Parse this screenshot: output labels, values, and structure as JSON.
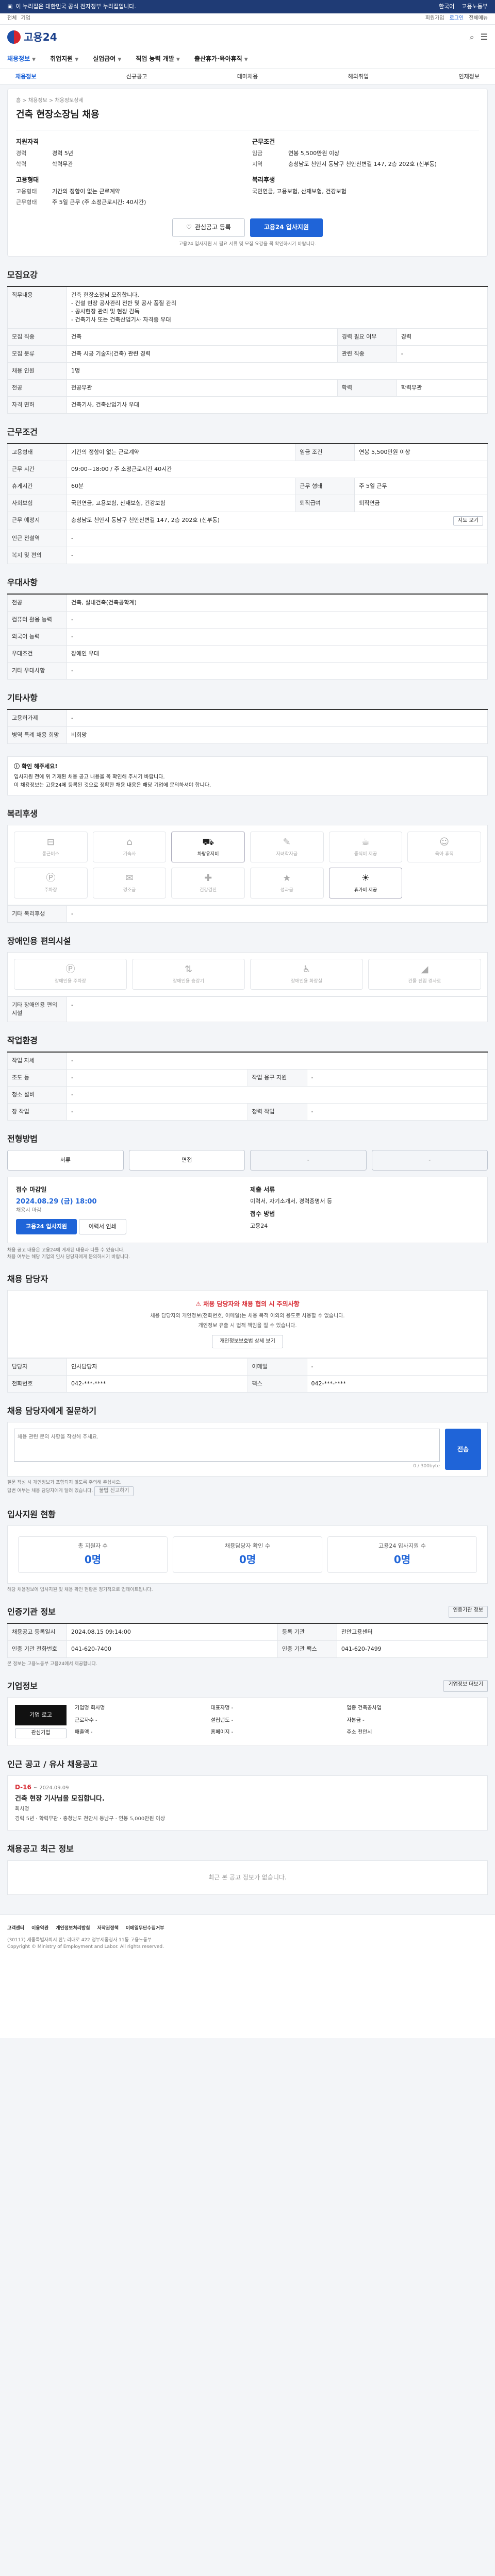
{
  "topbar": {
    "notice": "이 누리집은 대한민국 공식 전자정부 누리집입니다.",
    "lang": "한국어",
    "gov": "고용노동부"
  },
  "util": {
    "left": [
      "전체",
      "기업"
    ],
    "links": [
      "회원가입",
      "로그인",
      "전체메뉴"
    ]
  },
  "logo": "고용24",
  "gnb": [
    {
      "label": "채용정보",
      "on": true
    },
    {
      "label": "취업지원",
      "on": false
    },
    {
      "label": "실업급여",
      "on": false
    },
    {
      "label": "직업 능력 개발",
      "on": false
    },
    {
      "label": "출산휴가·육아휴직",
      "on": false
    }
  ],
  "subnav": [
    "채용정보",
    "신규공고",
    "테마채용",
    "해외취업",
    "인재정보"
  ],
  "job": {
    "crumb": "홈 > 채용정보 > 채용정보상세",
    "title": "건축 현장소장님 채용",
    "left_h": "지원자격",
    "req_rows": [
      {
        "k": "경력",
        "v": "경력 5년"
      },
      {
        "k": "학력",
        "v": "학력무관"
      }
    ],
    "left_h2": "고용형태",
    "emp_rows": [
      {
        "k": "고용형태",
        "v": "기간의 정함이 없는 근로계약"
      },
      {
        "k": "근무형태",
        "v": "주 5일 근무 (주 소정근로시간: 40시간)"
      }
    ],
    "right_h": "근무조건",
    "cond_rows": [
      {
        "k": "임금",
        "v": "연봉 5,500만원 이상"
      },
      {
        "k": "지역",
        "v": "충청남도 천안시 동남구 천안천변길 147, 2층 202호 (신부동)"
      }
    ],
    "right_h2": "복리후생",
    "welfare": "국민연금, 고용보험, 산재보험, 건강보험",
    "btn_bookmark": "관심공고 등록",
    "btn_apply": "고용24 입사지원",
    "apply_note": "고용24 입사지원 시 필요 서류 및 모집 요강을 꼭 확인하시기 바랍니다."
  },
  "sec_recruit": {
    "h": "모집요강",
    "job_h": "직무내용",
    "job_desc": [
      "건축 현장소장님 모집합니다.",
      "- 건설 현장 공사관리 전반 및 공사 품질 관리",
      "- 공사현장 관리 및 현장 감독",
      "- 건축기사 또는 건축산업기사 자격증 우대"
    ],
    "rows": [
      [
        "모집 직종",
        "건축",
        "경력 필요 여부",
        "경력"
      ],
      [
        "모집 분류",
        "건축 시공 기술자(건축) 관련 경력",
        "관련 직종",
        "-"
      ],
      [
        "채용 인원",
        "1명",
        "",
        ""
      ],
      [
        "전공",
        "전공무관",
        "학력",
        "학력무관"
      ],
      [
        "자격 면허",
        "건축기사, 건축산업기사 우대",
        "",
        ""
      ]
    ]
  },
  "sec_cond": {
    "h": "근무조건",
    "rows": [
      [
        "고용형태",
        "기간의 정함이 없는 근로계약",
        "임금 조건",
        "연봉 5,500만원 이상"
      ],
      [
        "근무 시간",
        "09:00~18:00 / 주 소정근로시간 40시간",
        "",
        ""
      ],
      [
        "휴게시간",
        "60분",
        "근무 형태",
        "주 5일 근무"
      ],
      [
        "사회보험",
        "국민연금, 고용보험, 산재보험, 건강보험",
        "퇴직급여",
        "퇴직연금"
      ],
      [
        "근무 예정지",
        "충청남도 천안시 동남구 천안천변길 147, 2층 202호 (신부동)",
        "",
        ""
      ],
      [
        "인근 전철역",
        "-",
        "",
        ""
      ],
      [
        "복지 및 편의",
        "-",
        "",
        ""
      ]
    ],
    "map_btn": "지도 보기"
  },
  "sec_welfare": {
    "h": "우대사항",
    "rows": [
      [
        "전공",
        "건축, 실내건축(건축공학계)"
      ],
      [
        "컴퓨터 활용 능력",
        "-"
      ],
      [
        "외국어 능력",
        "-"
      ],
      [
        "우대조건",
        "장애인 우대"
      ],
      [
        "기타 우대사항",
        "-"
      ]
    ]
  },
  "sec_etc": {
    "h": "기타사항",
    "rows": [
      [
        "고용허가제",
        "-"
      ],
      [
        "병역 특례 채용 희망",
        "비희망"
      ]
    ]
  },
  "warn": {
    "t": "확인 해주세요!",
    "lines": [
      "입사지원 전에 위 기재된 채용 공고 내용을 꼭 확인해 주시기 바랍니다.",
      "이 채용정보는 고용24에 등록된 것으로 정확한 채용 내용은 해당 기업에 문의하셔야 합니다."
    ]
  },
  "sec_benefit": {
    "h": "복리후생",
    "tiles": [
      {
        "label": "통근버스",
        "on": false
      },
      {
        "label": "기숙사",
        "on": false
      },
      {
        "label": "차량유지비",
        "on": true
      },
      {
        "label": "자녀학자금",
        "on": false
      },
      {
        "label": "중식비 제공",
        "on": false
      },
      {
        "label": "육아 휴직",
        "on": false
      },
      {
        "label": "주차장",
        "on": false
      },
      {
        "label": "경조금",
        "on": false
      },
      {
        "label": "건강검진",
        "on": false
      },
      {
        "label": "성과금",
        "on": false
      },
      {
        "label": "휴가비 제공",
        "on": true
      },
      {
        "label": "",
        "on": false
      }
    ],
    "other_label": "기타 복리후생",
    "other_val": "-"
  },
  "sec_disabled": {
    "h": "장애인용 편의시설",
    "tiles": [
      {
        "label": "장애인용 주차장",
        "on": false
      },
      {
        "label": "장애인용 승강기",
        "on": false
      },
      {
        "label": "장애인용 화장실",
        "on": false
      },
      {
        "label": "건물 진입 경사로",
        "on": false
      }
    ],
    "other_label": "기타 장애인용 편의시설",
    "other_val": "-"
  },
  "sec_env": {
    "h": "작업환경",
    "rows": [
      [
        "작업 자세",
        "-",
        "",
        ""
      ],
      [
        "조도 등",
        "-",
        "작업 용구 지원",
        "-"
      ],
      [
        "청소 설비",
        "-",
        "",
        ""
      ],
      [
        "장 작업",
        "-",
        "청력 작업",
        "-"
      ]
    ]
  },
  "sec_process": {
    "h": "전형방법",
    "steps": [
      {
        "label": "서류",
        "dim": false
      },
      {
        "label": "면접",
        "dim": false
      },
      {
        "label": "-",
        "dim": true
      },
      {
        "label": "-",
        "dim": true
      }
    ],
    "recruit_h": "접수 마감일",
    "recruit_date": "2024.08.29 (금) 18:00",
    "recruit_sub": "채용시 마감",
    "apply_btn": "고용24 입사지원",
    "print_btn": "이력서 인쇄",
    "doc_h": "제출 서류",
    "docs": "이력서, 자기소개서, 경력증명서 등",
    "method_h": "접수 방법",
    "method": "고용24"
  },
  "sec_notes": [
    "채용 공고 내용은 고용24에 게재된 내용과 다를 수 있습니다.",
    "채용 여부는 해당 기업의 인사 담당자에게 문의하시기 바랍니다."
  ],
  "sec_contact": {
    "h": "채용 담당자",
    "red_title": "채용 담당자와 채용 협의 시 주의사항",
    "lines": [
      "채용 담당자의 개인정보(전화번호, 이메일)는 채용 목적 이외의 용도로 사용할 수 없습니다.",
      "개인정보 유출 시 법적 책임을 질 수 있습니다."
    ],
    "btn": "개인정보보호법 상세 보기",
    "name_label": "담당자",
    "name": "인사담당자",
    "tel_label": "전화번호",
    "tel": "042-***-****",
    "fax_label": "팩스",
    "fax": "042-***-****",
    "email_label": "이메일",
    "email": "-"
  },
  "sec_inquiry": {
    "h": "채용 담당자에게 질문하기",
    "placeholder": "채용 관련 문의 사항을 작성해 주세요.",
    "count": "0 / 300byte",
    "btn": "전송",
    "notes": [
      "질문 작성 시 개인정보가 포함되지 않도록 주의해 주십시오.",
      "답변 여부는 채용 담당자에게 달려 있습니다."
    ],
    "report_btn": "불법 신고하기"
  },
  "sec_stats": {
    "h": "입사지원 현황",
    "items": [
      {
        "label": "총 지원자 수",
        "num": "0명"
      },
      {
        "label": "채용담당자 확인 수",
        "num": "0명"
      },
      {
        "label": "고용24 입사지원 수",
        "num": "0명"
      }
    ],
    "note": "해당 채용정보에 입사지원 및 채용 확인 현황은 정기적으로 업데이트됩니다."
  },
  "sec_manage": {
    "h": "인증기관 정보",
    "btn": "인증기관 정보",
    "rows": [
      [
        "채용공고 등록일시",
        "2024.08.15 09:14:00",
        "등록 기관",
        "천안고용센터"
      ],
      [
        "인증 기관 전화번호",
        "041-620-7400",
        "인증 기관 팩스",
        "041-620-7499"
      ]
    ],
    "note": "본 정보는 고용노동부 고용24에서 제공합니다."
  },
  "sec_company": {
    "h": "기업정보",
    "more": "기업정보 더보기",
    "logo": "기업 로고",
    "bookmark": "관심기업",
    "items": [
      "기업명 회사명",
      "대표자명 -",
      "업종 건축공사업",
      "근로자수 -",
      "설립년도 -",
      "자본금 -",
      "매출액 -",
      "홈페이지 -",
      "주소 천안시"
    ]
  },
  "sec_related": {
    "h": "인근 공고 / 유사 채용공고",
    "dday": "D-16",
    "date": "~ 2024.09.09",
    "title": "건축 현장 기사님을 모집합니다.",
    "company": "회사명",
    "rows": [
      "경력 5년",
      "학력무관",
      "충청남도 천안시 동남구",
      "연봉 5,000만원 이상"
    ]
  },
  "sec_recent": {
    "h": "채용공고 최근 정보",
    "empty": "최근 본 공고 정보가 없습니다."
  },
  "footer": {
    "links": [
      "고객센터",
      "이용약관",
      "개인정보처리방침",
      "저작권정책",
      "이메일무단수집거부"
    ],
    "addr": "(30117) 세종특별자치시 한누리대로 422 정부세종청사 11동 고용노동부",
    "copy": "Copyright © Ministry of Employment and Labor. All rights reserved."
  }
}
